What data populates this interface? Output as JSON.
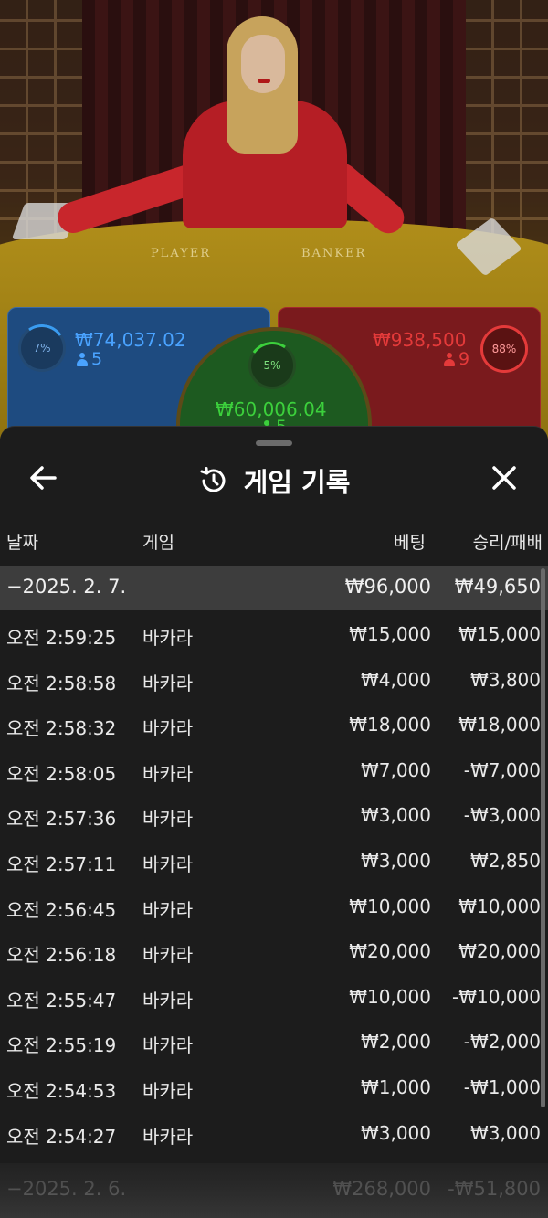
{
  "scene": {
    "table_labels": [
      "PLAYER",
      "BANKER"
    ]
  },
  "bets": {
    "player": {
      "percent": "7%",
      "amount": "₩74,037.02",
      "count": "5",
      "color": "#3a9cf0"
    },
    "tie": {
      "percent": "5%",
      "amount": "₩60,006.04",
      "count": "5",
      "color": "#3cd03c"
    },
    "banker": {
      "percent": "88%",
      "amount": "₩938,500",
      "count": "9",
      "color": "#e43a3a"
    }
  },
  "history": {
    "title": "게임 기록",
    "columns": {
      "date": "날짜",
      "game": "게임",
      "bet": "베팅",
      "winloss": "승리/패배"
    },
    "date_group": {
      "date": "−2025. 2. 7.",
      "bet": "₩96,000",
      "winloss": "₩49,650"
    },
    "rows": [
      {
        "time": "오전 2:59:25",
        "game": "바카라",
        "bet": "₩15,000",
        "winloss": "₩15,000"
      },
      {
        "time": "오전 2:58:58",
        "game": "바카라",
        "bet": "₩4,000",
        "winloss": "₩3,800"
      },
      {
        "time": "오전 2:58:32",
        "game": "바카라",
        "bet": "₩18,000",
        "winloss": "₩18,000"
      },
      {
        "time": "오전 2:58:05",
        "game": "바카라",
        "bet": "₩7,000",
        "winloss": "-₩7,000"
      },
      {
        "time": "오전 2:57:36",
        "game": "바카라",
        "bet": "₩3,000",
        "winloss": "-₩3,000"
      },
      {
        "time": "오전 2:57:11",
        "game": "바카라",
        "bet": "₩3,000",
        "winloss": "₩2,850"
      },
      {
        "time": "오전 2:56:45",
        "game": "바카라",
        "bet": "₩10,000",
        "winloss": "₩10,000"
      },
      {
        "time": "오전 2:56:18",
        "game": "바카라",
        "bet": "₩20,000",
        "winloss": "₩20,000"
      },
      {
        "time": "오전 2:55:47",
        "game": "바카라",
        "bet": "₩10,000",
        "winloss": "-₩10,000"
      },
      {
        "time": "오전 2:55:19",
        "game": "바카라",
        "bet": "₩2,000",
        "winloss": "-₩2,000"
      },
      {
        "time": "오전 2:54:53",
        "game": "바카라",
        "bet": "₩1,000",
        "winloss": "-₩1,000"
      },
      {
        "time": "오전 2:54:27",
        "game": "바카라",
        "bet": "₩3,000",
        "winloss": "₩3,000"
      }
    ],
    "next_group": {
      "date": "−2025. 2. 6.",
      "bet": "₩268,000",
      "winloss": "-₩51,800"
    },
    "icons": {
      "back": "back-arrow-icon",
      "history": "history-clock-icon",
      "close": "close-icon"
    }
  }
}
